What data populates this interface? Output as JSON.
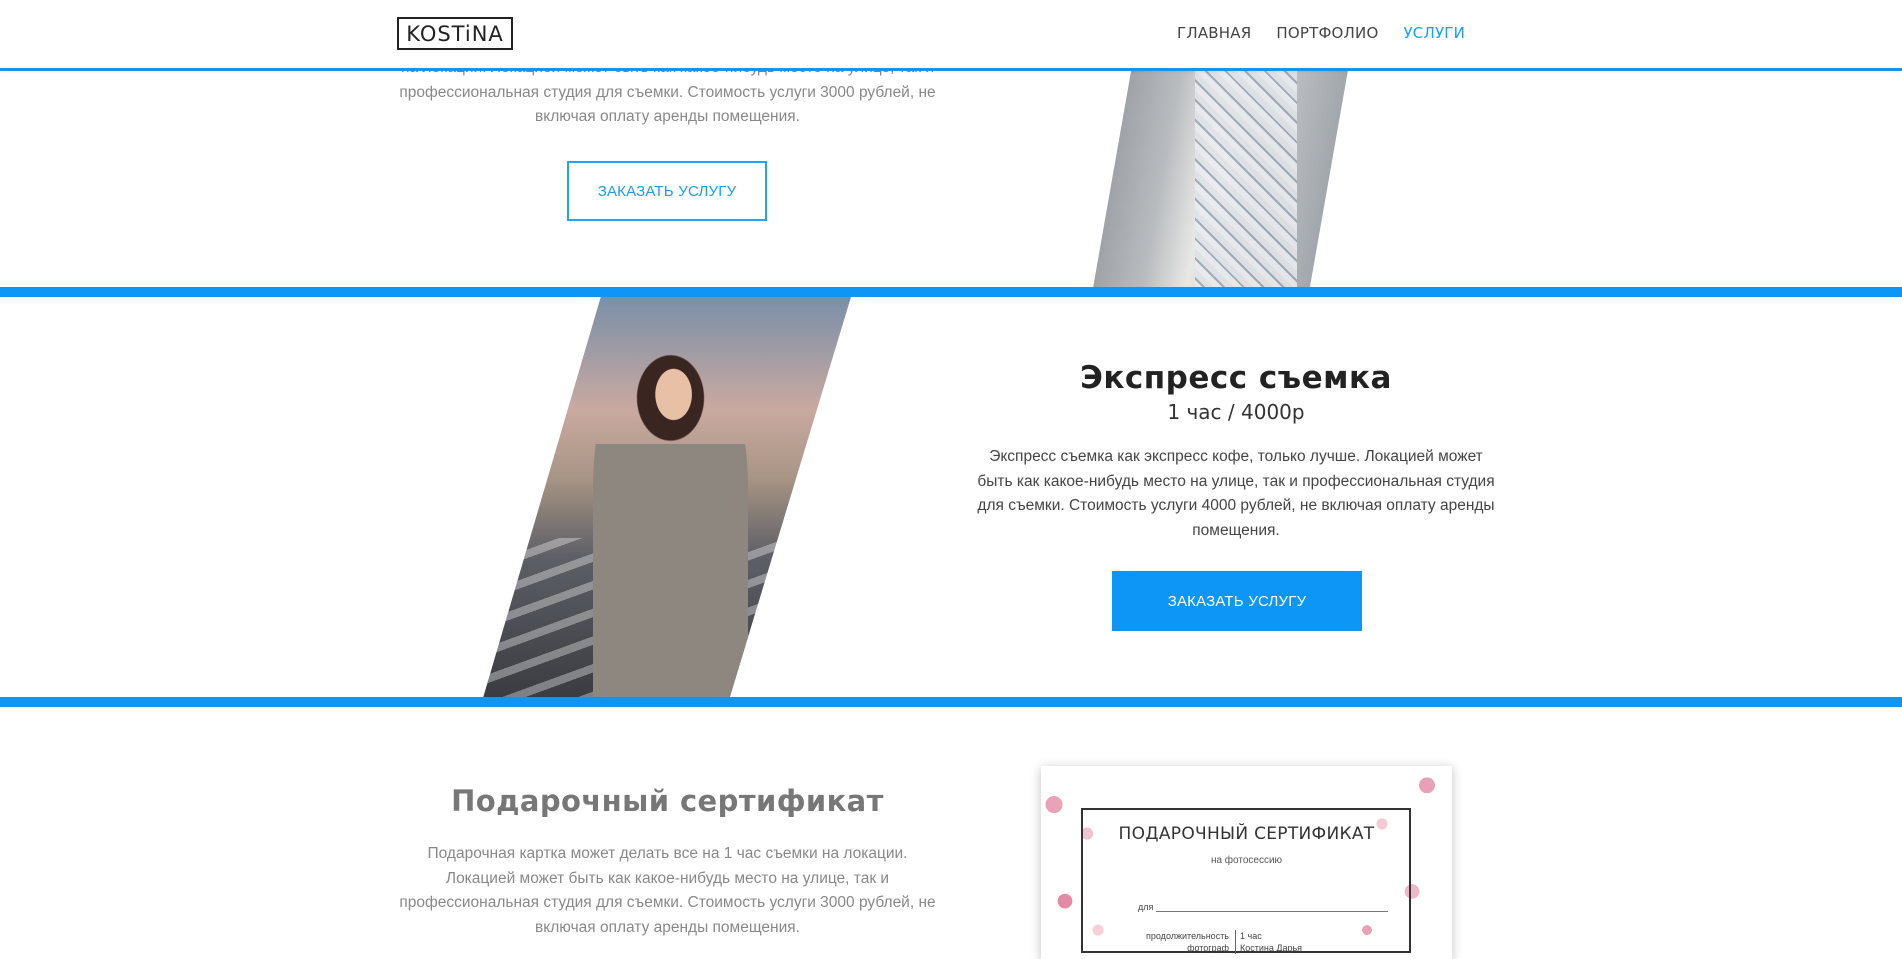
{
  "header": {
    "logo": "KOSTiNA",
    "nav": [
      {
        "label": "ГЛАВНАЯ",
        "active": false
      },
      {
        "label": "ПОРТФОЛИО",
        "active": false
      },
      {
        "label": "УСЛУГИ",
        "active": true
      }
    ]
  },
  "section_top": {
    "text": "на локации. Локацией может быть как какое-нибудь место на улице, так и профессиональная студия для съемки. Стоимость услуги 3000 рублей, не включая оплату аренды помещения.",
    "button": "ЗАКАЗАТЬ УСЛУГУ"
  },
  "section_express": {
    "title": "Экспресс съемка",
    "subtitle": "1 час / 4000р",
    "text": "Экспресс съемка как экспресс кофе, только лучше. Локацией может быть как какое-нибудь место на улице, так и профессиональная студия для съемки. Стоимость услуги 4000 рублей, не включая оплату аренды помещения.",
    "button": "ЗАКАЗАТЬ УСЛУГУ"
  },
  "section_gift": {
    "title": "Подарочный сертификат",
    "text": "Подарочная картка может делать все на 1 час съемки на локации. Локацией может быть как какое-нибудь место на улице, так и профессиональная студия для съемки. Стоимость услуги 3000 рублей, не включая оплату аренды помещения.",
    "certificate": {
      "title": "ПОДАРОЧНЫЙ СЕРТИФИКАТ",
      "subtitle": "на фотосессию",
      "for_label": "для",
      "duration_label": "продолжительность",
      "duration_value": "1 час",
      "photographer_label": "фотограф",
      "photographer_value": "Костина Дарья"
    }
  },
  "colors": {
    "accent": "#0d96f5",
    "link_active": "#1a9cf0"
  }
}
